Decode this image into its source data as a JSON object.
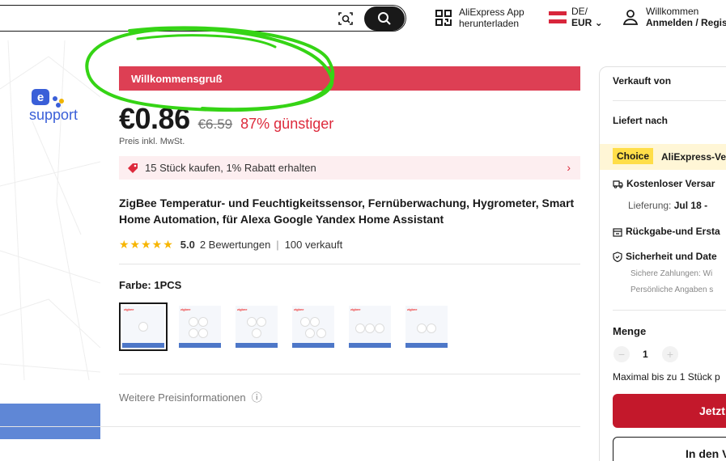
{
  "header": {
    "app_line1": "AliExpress App",
    "app_line2": "herunterladen",
    "lang_line1": "DE/",
    "lang_line2": "EUR",
    "user_line1": "Willkommen",
    "user_line2": "Anmelden / Regist"
  },
  "gallery": {
    "logo_letter": "e",
    "logo_text": "support"
  },
  "product": {
    "welcome_label": "Willkommensgruß",
    "price": "€0.86",
    "price_old": "€6.59",
    "discount": "87% günstiger",
    "vat_note": "Preis inkl. MwSt.",
    "promo_text": "15 Stück kaufen, 1% Rabatt erhalten",
    "title": "ZigBee Temperatur- und Feuchtigkeitssensor, Fernüberwachung, Hygrometer, Smart Home Automation, für Alexa Google Yandex Home Assistant",
    "rating_score": "5.0",
    "rating_count": "2 Bewertungen",
    "sold": "100 verkauft",
    "color_label": "Farbe: 1PCS",
    "more_info": "Weitere Preisinformationen",
    "thumb_brand": "zigbee"
  },
  "panel": {
    "sold_by": "Verkauft von",
    "ship_to": "Liefert nach",
    "choice_badge": "Choice",
    "choice_text": "AliExpress-Ve",
    "free_shipping": "Kostenloser Versar",
    "delivery_label": "Lieferung:",
    "delivery_date": "Jul 18 - ",
    "returns": "Rückgabe-und Ersta",
    "security": "Sicherheit und Date",
    "secure_payments": "Sichere Zahlungen: Wi",
    "personal_data": "Persönliche Angaben s",
    "qty_label": "Menge",
    "qty_value": "1",
    "qty_minus": "−",
    "qty_plus": "+",
    "max_note": "Maximal bis zu 1 Stück p",
    "buy_button": "Jetzt",
    "cart_button": "In den V"
  },
  "colors": {
    "accent_red": "#dd3f54",
    "buy_red": "#c3182b",
    "choice_yellow": "#ffde49",
    "annotation_green": "#35d415"
  }
}
